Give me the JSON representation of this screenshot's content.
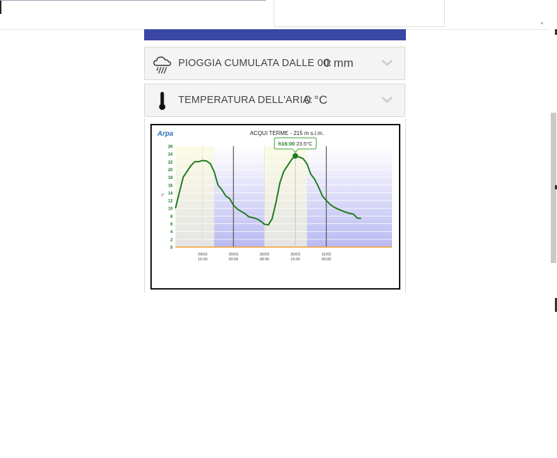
{
  "accordions": [
    {
      "icon": "rain-cloud-icon",
      "label": "PIOGGIA CUMULATA DALLE 00:",
      "value": "0 mm"
    },
    {
      "icon": "thermometer-icon",
      "label": "TEMPERATURA DELL'ARIA:",
      "value": "0 °C"
    }
  ],
  "chart": {
    "logo_text": "Arpa",
    "tooltip": {
      "time": "h16:00",
      "value": "23.5°C"
    }
  },
  "chart_data": {
    "type": "line",
    "title": "ACQUI TERME - 215 m s.l.m.",
    "ylabel": "t°",
    "ylim": [
      0,
      26
    ],
    "yticks": [
      0,
      2,
      4,
      6,
      8,
      10,
      12,
      14,
      16,
      18,
      20,
      22,
      24,
      26
    ],
    "x_range_hours": [
      0,
      56
    ],
    "xticks": [
      {
        "h": 7,
        "line1": "29/03",
        "line2": "16:00"
      },
      {
        "h": 15,
        "line1": "30/03",
        "line2": "00:00"
      },
      {
        "h": 23,
        "line1": "30/03",
        "line2": "08:00"
      },
      {
        "h": 31,
        "line1": "30/03",
        "line2": "16:00"
      },
      {
        "h": 39,
        "line1": "31/03",
        "line2": "00:00"
      }
    ],
    "day_separators_h": [
      15,
      39
    ],
    "series": [
      {
        "color": "#1e7a1e",
        "x": [
          0,
          2,
          4,
          5,
          6,
          7,
          8,
          9,
          10,
          11,
          12,
          13,
          14,
          15,
          16,
          17,
          18,
          19,
          20,
          21,
          22,
          23,
          24,
          25,
          26,
          27,
          28,
          29,
          30,
          31,
          32,
          33,
          34,
          35,
          36,
          37,
          38,
          39,
          40,
          41,
          42,
          43,
          44,
          45,
          46,
          47,
          48
        ],
        "y": [
          10,
          18,
          21,
          22,
          22,
          22.3,
          22.2,
          21.5,
          19.5,
          16,
          14.8,
          13.2,
          12.5,
          10.8,
          9.8,
          9.2,
          8.6,
          7.8,
          7.6,
          7.3,
          6.7,
          5.9,
          5.7,
          7.3,
          11.5,
          16.5,
          19.5,
          21,
          22.5,
          23.5,
          23.2,
          22.8,
          21.5,
          18.8,
          17.5,
          15.5,
          13.2,
          12,
          11,
          10.3,
          9.8,
          9.4,
          9,
          8.7,
          8.5,
          7.5,
          7.4
        ]
      }
    ],
    "highlight_point": {
      "x": 31,
      "y": 23.5
    },
    "daylight_bands_h": [
      [
        0,
        10
      ],
      [
        23,
        34
      ]
    ],
    "colors": {
      "line": "#1e7a1e",
      "zero_line": "#f2a22c",
      "separator": "#555555",
      "ytick_text": "#1a7a1a"
    }
  }
}
